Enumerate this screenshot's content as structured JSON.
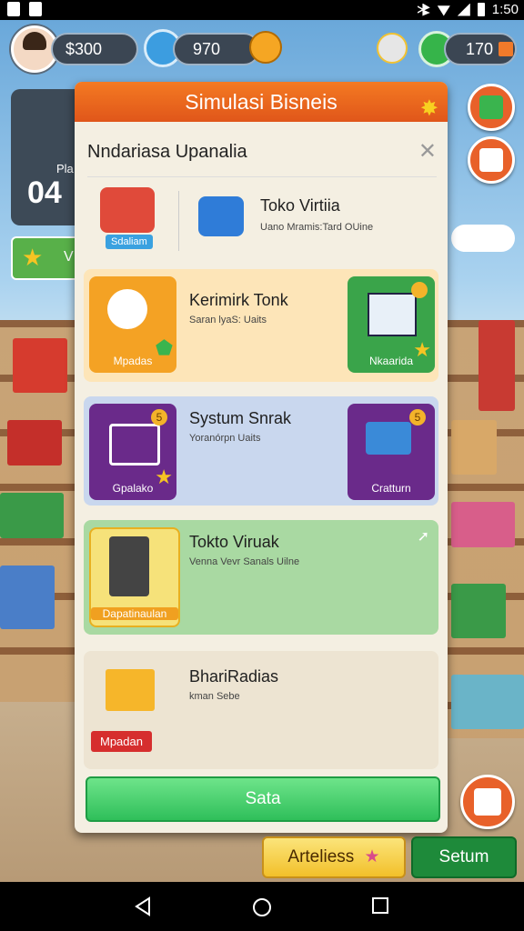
{
  "status": {
    "time": "1:50"
  },
  "hud": {
    "cash": "$300",
    "gems": "970",
    "coins": "170"
  },
  "bg": {
    "card_num": "04",
    "card_label": "Pla",
    "star_label": "V"
  },
  "modal": {
    "title": "Simulasi Bisneis",
    "subtitle": "Nndariasa Upanalia",
    "top_item": {
      "tag": "Sdaliam",
      "title": "Toko Virtiia",
      "desc": "Uano Mramis:Tard OUine"
    },
    "cards": [
      {
        "title": "Kerimirk Tonk",
        "desc": "Saran lyaS: Uaits",
        "left_label": "Mpadas",
        "right_label": "Nkaarida",
        "bg": "#fde5b8"
      },
      {
        "title": "Systum Snrak",
        "desc": "Yoranórpn Uaits",
        "left_label": "Gpalako",
        "right_label": "Cratturn",
        "bg": "#c9d7ee",
        "coin_left": "5",
        "coin_right": "5"
      },
      {
        "title": "Tokto Viruak",
        "desc": "Venna Vevr Sanals Uilne",
        "left_label": "Dapatinaulan",
        "bg": "#a9d9a2"
      },
      {
        "title": "BhariRadias",
        "desc": "kman Sebe",
        "left_label": "Mpadan",
        "bg": "#ede4d2"
      }
    ],
    "primary_label": "Sata"
  },
  "bottom": {
    "left_label": "Arteliess",
    "right_label": "Setum"
  }
}
